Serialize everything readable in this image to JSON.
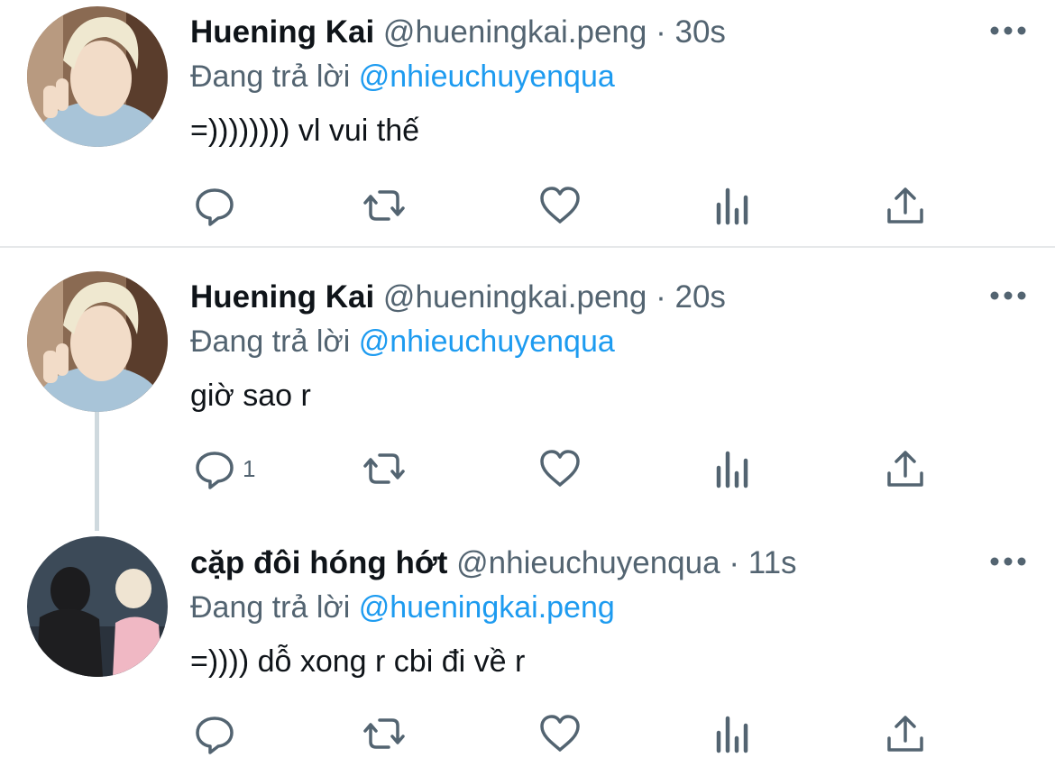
{
  "tweets": [
    {
      "name": "Huening Kai",
      "handle": "@hueningkai.peng",
      "sep": "·",
      "time": "30s",
      "replying_prefix": "Đang trả lời",
      "replying_to": "@nhieuchuyenqua",
      "text": "=)))))))) vl vui thế",
      "reply_count": ""
    },
    {
      "name": "Huening Kai",
      "handle": "@hueningkai.peng",
      "sep": "·",
      "time": "20s",
      "replying_prefix": "Đang trả lời",
      "replying_to": "@nhieuchuyenqua",
      "text": "giờ sao r",
      "reply_count": "1"
    },
    {
      "name": "cặp đôi hóng hớt",
      "handle": "@nhieuchuyenqua",
      "sep": "·",
      "time": "11s",
      "replying_prefix": "Đang trả lời",
      "replying_to": "@hueningkai.peng",
      "text": "=)))) dỗ xong r cbi đi về r",
      "reply_count": ""
    }
  ],
  "icons": {
    "reply": "reply-icon",
    "retweet": "retweet-icon",
    "like": "like-icon",
    "analytics": "analytics-icon",
    "share": "share-icon",
    "more": "more-icon"
  },
  "colors": {
    "text": "#0f1419",
    "secondary": "#536471",
    "link": "#1d9bf0",
    "divider": "#e6e8ea",
    "thread_line": "#cfd9de"
  }
}
